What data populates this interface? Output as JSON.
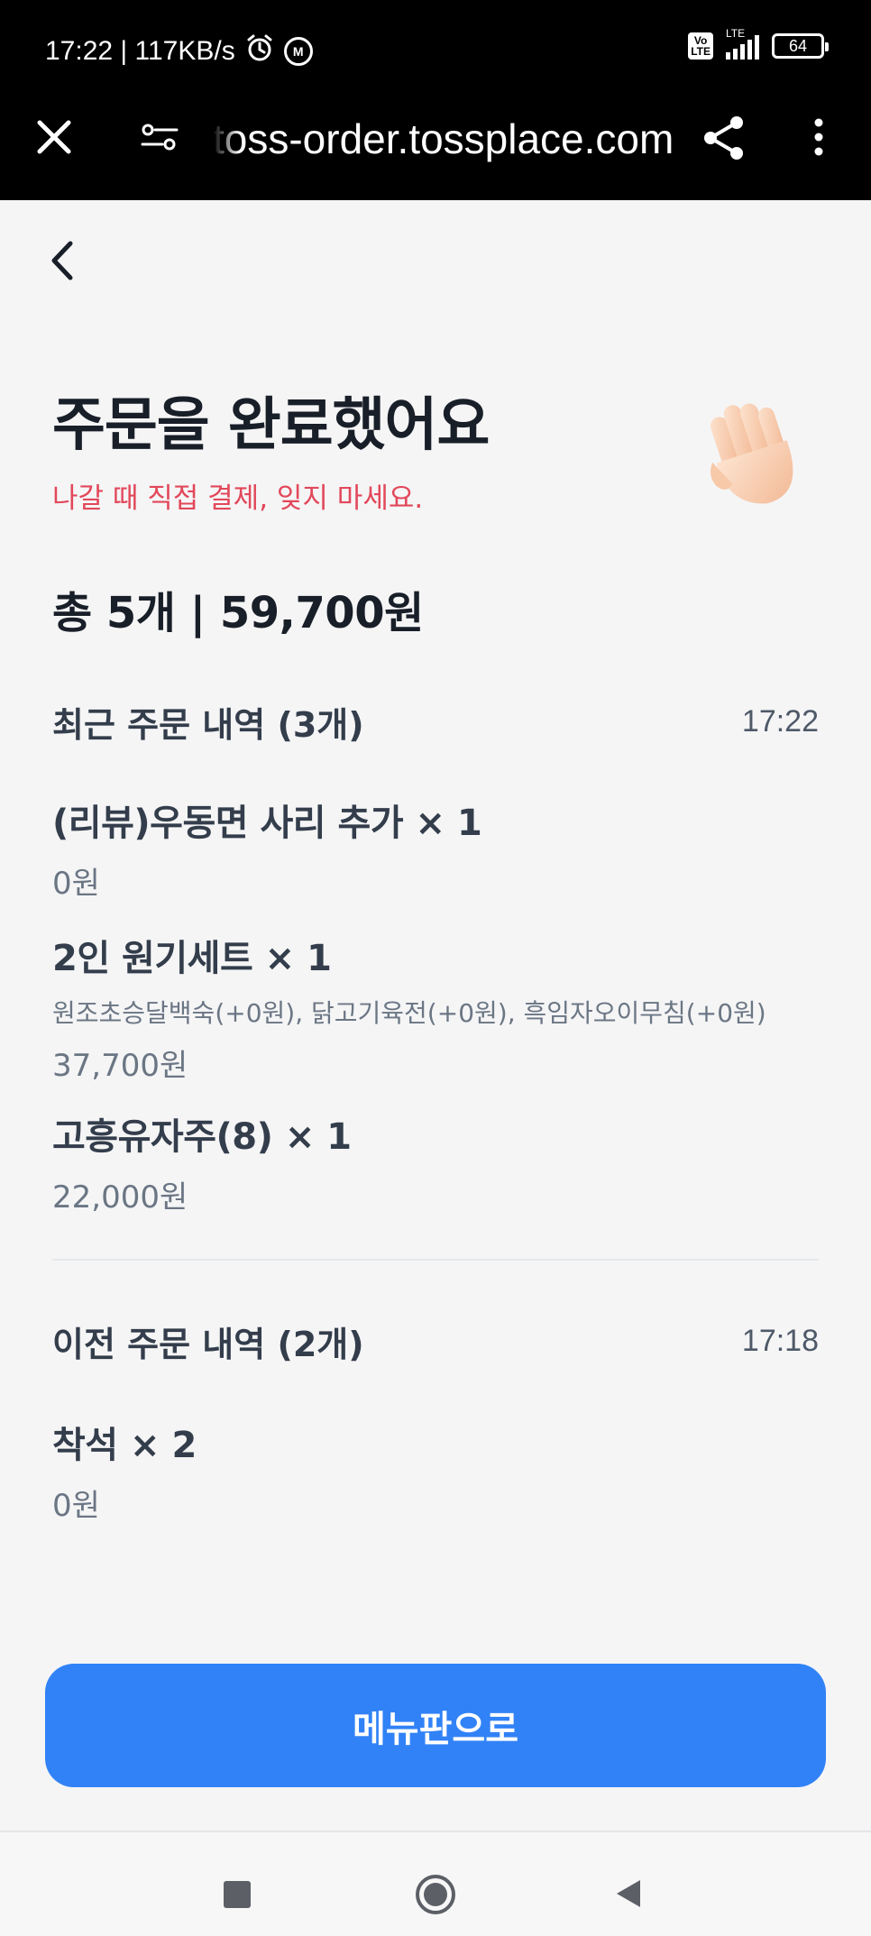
{
  "status_bar": {
    "time_speed": "17:22 | 117KB/s",
    "volte_label": "Vo\nLTE",
    "network_label": "LTE",
    "battery": "64"
  },
  "browser": {
    "url": "toss-order.tossplace.com",
    "icons": [
      "close-icon",
      "tune-icon",
      "share-icon",
      "more-vert-icon"
    ]
  },
  "header": {
    "title": "주문을 완료했어요",
    "subtitle": "나갈 때 직접 결제, 잊지 마세요.",
    "emoji": "waving-hand-emoji"
  },
  "summary": {
    "total_text": "총 5개 | 59,700원"
  },
  "recent_orders": {
    "title": "최근 주문 내역 (3개)",
    "time": "17:22",
    "items": [
      {
        "name": "(리뷰)우동면 사리 추가 × 1",
        "options": "",
        "price": "0원"
      },
      {
        "name": "2인 원기세트 × 1",
        "options": "원조초승달백숙(+0원), 닭고기육전(+0원), 흑임자오이무침(+0원)",
        "price": "37,700원"
      },
      {
        "name": "고흥유자주(8) × 1",
        "options": "",
        "price": "22,000원"
      }
    ]
  },
  "previous_orders": {
    "title": "이전 주문 내역 (2개)",
    "time": "17:18",
    "items": [
      {
        "name": "착석 × 2",
        "options": "",
        "price": "0원"
      }
    ]
  },
  "cta": {
    "label": "메뉴판으로"
  },
  "colors": {
    "accent": "#3182f6",
    "warning_text": "#e2485a",
    "background": "#f5f5f6"
  }
}
